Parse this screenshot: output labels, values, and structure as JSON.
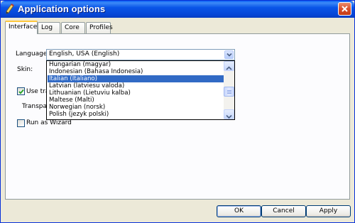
{
  "window": {
    "title": "Application options",
    "title_icon": "pencil-icon",
    "close_icon": "close-icon"
  },
  "tabs": [
    {
      "label": "Interface",
      "active": true
    },
    {
      "label": "Log",
      "active": false
    },
    {
      "label": "Core",
      "active": false
    },
    {
      "label": "Profiles",
      "active": false
    }
  ],
  "interface": {
    "language_label": "Language:",
    "language_value": "English, USA (English)",
    "skin_label": "Skin:",
    "use_transparency_label": "Use tra",
    "use_transparency_checked": true,
    "transparency_label": "Transpare",
    "run_as_wizard_label": "Run as Wizard",
    "run_as_wizard_checked": false
  },
  "language_dropdown": {
    "items": [
      "Hungarian (magyar)",
      "Indonesian (Bahasa Indonesia)",
      "Italian (Italiano)",
      "Latvian (latviesu valoda)",
      "Lithuanian (Lietuviu kalba)",
      "Maltese (Malti)",
      "Norwegian (norsk)",
      "Polish (jezyk polski)"
    ],
    "selected_index": 2
  },
  "buttons": {
    "ok": "OK",
    "cancel": "Cancel",
    "apply": "Apply"
  },
  "colors": {
    "titlebar": "#0a55e8",
    "selection": "#316ac5",
    "tab_highlight": "#ffc83c",
    "window_bg": "#ece9d8"
  }
}
